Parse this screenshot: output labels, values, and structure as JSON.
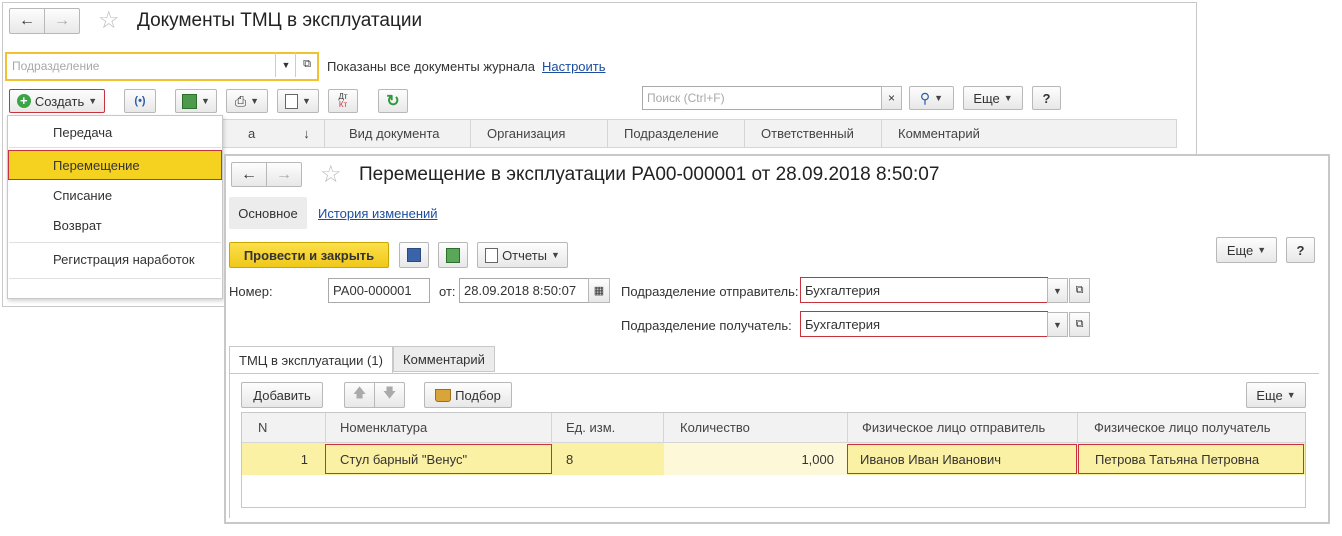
{
  "journal": {
    "title": "Документы ТМЦ в эксплуатации",
    "subdivision_placeholder": "Подразделение",
    "shown_text": "Показаны все документы журнала",
    "configure_link": "Настроить",
    "create_label": "Создать",
    "dt_kt_top": "Дт",
    "dt_kt_bottom": "Кт",
    "search_placeholder": "Поиск (Ctrl+F)",
    "more_label": "Еще",
    "help_label": "?",
    "columns": [
      "а",
      "Вид документа",
      "Организация",
      "Подразделение",
      "Ответственный",
      "Комментарий"
    ],
    "create_menu": [
      "Передача",
      "Перемещение",
      "Списание",
      "Возврат",
      "Регистрация наработок"
    ],
    "selected_menu_item": "Перемещение"
  },
  "document": {
    "title": "Перемещение в эксплуатации РА00-000001 от 28.09.2018 8:50:07",
    "tab_main": "Основное",
    "tab_history": "История изменений",
    "post_close_label": "Провести и закрыть",
    "reports_label": "Отчеты",
    "more_label": "Еще",
    "help_label": "?",
    "number_label": "Номер:",
    "number_value": "РА00-000001",
    "from_label": "от:",
    "date_value": "28.09.2018  8:50:07",
    "sender_label": "Подразделение отправитель:",
    "sender_value": "Бухгалтерия",
    "receiver_label": "Подразделение получатель:",
    "receiver_value": "Бухгалтерия",
    "tabs": [
      "ТМЦ в эксплуатации (1)",
      "Комментарий"
    ],
    "add_label": "Добавить",
    "pick_label": "Подбор",
    "table_more_label": "Еще",
    "table_columns": [
      "N",
      "Номенклатура",
      "Ед. изм.",
      "Количество",
      "Физическое лицо отправитель",
      "Физическое лицо получатель"
    ],
    "rows": [
      {
        "n": "1",
        "item": "Стул барный \"Венус\"",
        "unit": "8",
        "qty": "1,000",
        "sender_person": "Иванов Иван Иванович",
        "receiver_person": "Петрова Татьяна Петровна"
      }
    ]
  },
  "colors": {
    "accent_yellow": "#f5d21f",
    "highlight_row": "#fbf1a4",
    "error_red": "#c8323c",
    "link_blue": "#1b4ea0"
  }
}
